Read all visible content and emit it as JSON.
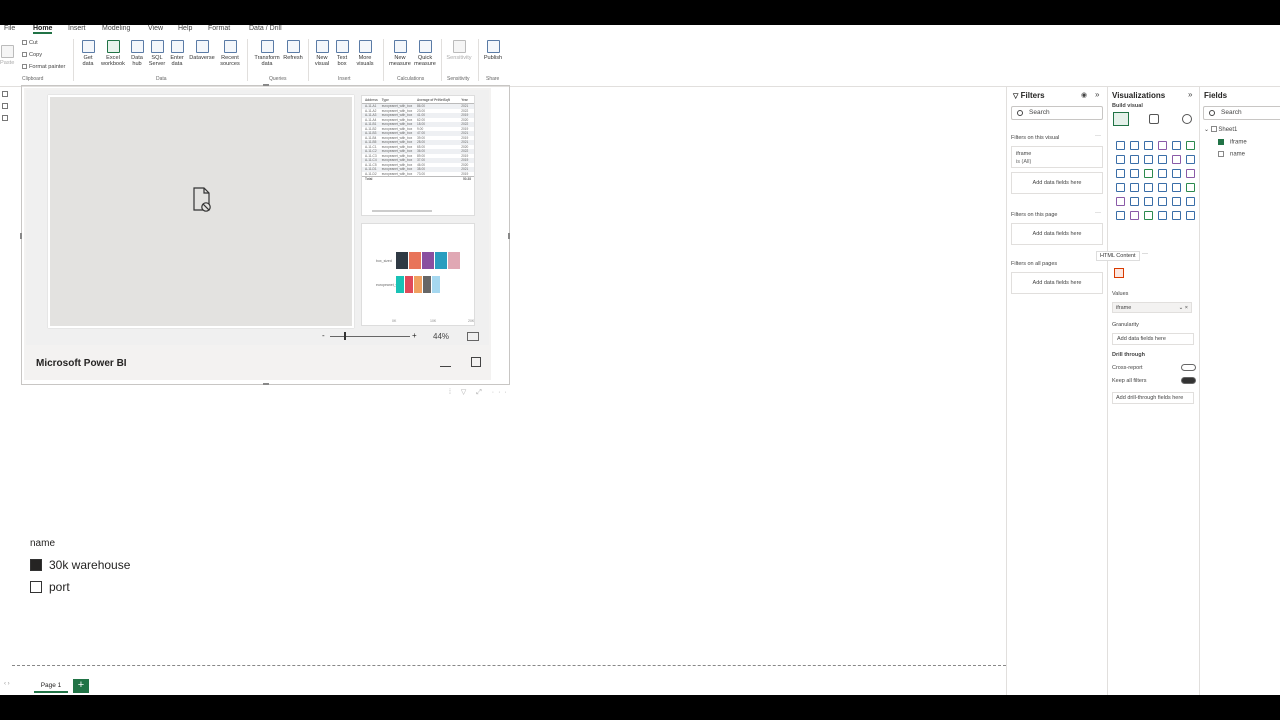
{
  "menu": {
    "items": [
      "File",
      "Home",
      "Insert",
      "Modeling",
      "View",
      "Help",
      "Format",
      "Data / Drill"
    ],
    "active": "Home"
  },
  "ribbon": {
    "clipboard": {
      "cut": "Cut",
      "copy": "Copy",
      "paste": "Paste",
      "format_painter": "Format painter",
      "group": "Clipboard"
    },
    "data": {
      "buttons": [
        "Get data",
        "Excel workbook",
        "Data hub",
        "SQL Server",
        "Enter data",
        "Dataverse",
        "Recent sources"
      ],
      "group": "Data"
    },
    "queries": {
      "buttons": [
        "Transform data",
        "Refresh"
      ],
      "group": "Queries"
    },
    "insert": {
      "buttons": [
        "New visual",
        "Text box",
        "More visuals"
      ],
      "group": "Insert"
    },
    "calculations": {
      "buttons": [
        "New measure",
        "Quick measure"
      ],
      "group": "Calculations"
    },
    "sensitivity": {
      "buttons": [
        "Sensitivity"
      ],
      "group": "Sensitivity"
    },
    "share": {
      "buttons": [
        "Publish"
      ],
      "group": "Share"
    }
  },
  "embedded_report": {
    "brand": "Microsoft Power BI",
    "zoom": "44%",
    "zoom_minus": "-",
    "zoom_plus": "+",
    "table": {
      "headers": [
        "Address",
        "Type",
        "Average of PriNetSqft",
        "Year"
      ],
      "rows": [
        [
          "A-11-A1",
          "europeanet_with_box",
          "86.00",
          "2021"
        ],
        [
          "A-11-A2",
          "europeanet_with_box",
          "23.00",
          "2022"
        ],
        [
          "A-11-A3",
          "europeanet_with_box",
          "41.00",
          "2019"
        ],
        [
          "A-11-A4",
          "europeanet_with_box",
          "62.00",
          "2020"
        ],
        [
          "A-11-B1",
          "europeanet_with_box",
          "18.00",
          "2022"
        ],
        [
          "A-11-B2",
          "europeanet_with_box",
          "9.00",
          "2019"
        ],
        [
          "A-11-B3",
          "europeanet_with_box",
          "47.00",
          "2021"
        ],
        [
          "A-11-B4",
          "europeanet_with_box",
          "39.00",
          "2019"
        ],
        [
          "A-11-B5",
          "europeanet_with_box",
          "28.00",
          "2021"
        ],
        [
          "A-11-C1",
          "europeanet_with_box",
          "65.00",
          "2020"
        ],
        [
          "A-11-C2",
          "europeanet_with_box",
          "36.00",
          "2022"
        ],
        [
          "A-11-C3",
          "europeanet_with_box",
          "89.00",
          "2019"
        ],
        [
          "A-11-C4",
          "europeanet_with_box",
          "37.00",
          "2019"
        ],
        [
          "A-11-C5",
          "europeanet_with_box",
          "46.00",
          "2020"
        ],
        [
          "A-11-D1",
          "europeanet_with_box",
          "38.00",
          "2021"
        ],
        [
          "A-11-D2",
          "europeanet_with_box",
          "73.00",
          "2019"
        ]
      ],
      "total_label": "Total",
      "total_value": "50.38"
    },
    "matrix": {
      "row_labels": [
        "box_sized",
        "europeanet_wi..."
      ],
      "row1_colors": [
        "#2f3a44",
        "#e8745a",
        "#8a4fa0",
        "#2a9dbf",
        "#e0a8b4"
      ],
      "row2_colors": [
        "#19c2b6",
        "#e04a5a",
        "#f0a060",
        "#666666",
        "#a6d8f0"
      ],
      "axis_ticks": [
        "0K",
        "10K",
        "20K"
      ]
    }
  },
  "slicer": {
    "title": "name",
    "items": [
      {
        "label": "30k warehouse",
        "checked": true
      },
      {
        "label": "port",
        "checked": false
      }
    ]
  },
  "pages": {
    "tab": "Page 1",
    "add": "+",
    "arrows": "‹ ›"
  },
  "filters": {
    "title": "Filters",
    "search_placeholder": "Search",
    "on_visual": "Filters on this visual",
    "visual_field": "iframe",
    "visual_field_state": "is (All)",
    "add_here": "Add data fields here",
    "on_page": "Filters on this page",
    "on_all": "Filters on all pages",
    "more": "···"
  },
  "visualizations": {
    "title": "Visualizations",
    "build_visual": "Build visual",
    "tooltip": "HTML Content",
    "values": "Values",
    "value_field": "iframe",
    "granularity": "Granularity",
    "add_here": "Add data fields here",
    "drill_through": "Drill through",
    "cross_report": "Cross-report",
    "cross_report_state": "Off",
    "keep_all_filters": "Keep all filters",
    "keep_all_state": "On",
    "add_drill": "Add drill-through fields here",
    "more": "···"
  },
  "fields": {
    "title": "Fields",
    "search_placeholder": "Search",
    "table": "Sheet1",
    "items": [
      {
        "label": "iframe",
        "checked": true
      },
      {
        "label": "name",
        "checked": false
      }
    ]
  }
}
